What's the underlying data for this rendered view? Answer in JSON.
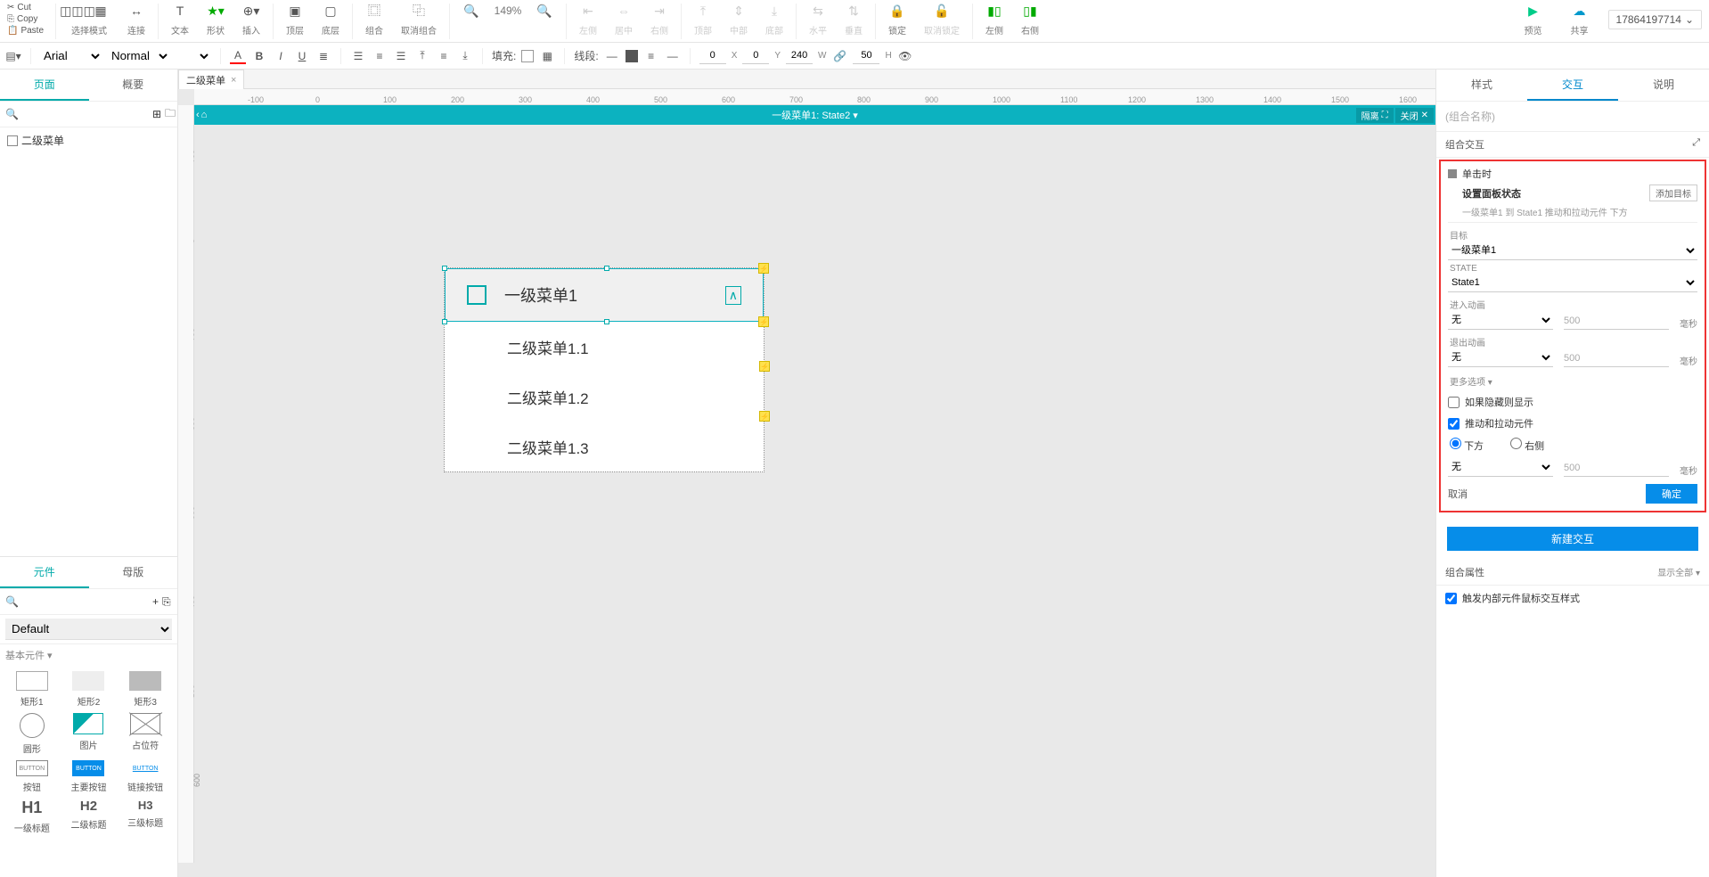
{
  "toolbar": {
    "clipboard": {
      "cut": "Cut",
      "copy": "Copy",
      "paste": "Paste"
    },
    "groups": {
      "selectmode": "选择模式",
      "connect": "连接",
      "text": "文本",
      "shape": "形状",
      "insert": "插入",
      "front": "顶层",
      "back": "底层",
      "group": "组合",
      "ungroup": "取消组合",
      "left": "左侧",
      "center": "居中",
      "right": "右侧",
      "top": "顶部",
      "middle": "中部",
      "bottom": "底部",
      "horiz": "水平",
      "vert": "垂直",
      "lock": "锁定",
      "unlock": "取消锁定",
      "leftpane": "左侧",
      "rightpane": "右侧",
      "preview": "预览",
      "share": "共享"
    },
    "zoom": "149%",
    "account": "17864197714"
  },
  "toolbar2": {
    "font": "Arial",
    "style": "Normal",
    "fill": "填充:",
    "line": "线段:",
    "x": "0",
    "y": "0",
    "w": "240",
    "h": "50",
    "xl": "X",
    "yl": "Y",
    "wl": "W",
    "hl": "H"
  },
  "leftPanel": {
    "tabs": {
      "pages": "页面",
      "outline": "概要"
    },
    "tree": [
      "二级菜单"
    ],
    "widgetsTabs": {
      "widgets": "元件",
      "masters": "母版"
    },
    "libDefault": "Default",
    "section": "基本元件 ▾",
    "widgets": [
      {
        "lbl": "矩形1",
        "t": "rect"
      },
      {
        "lbl": "矩形2",
        "t": "rectf"
      },
      {
        "lbl": "矩形3",
        "t": "rectd"
      },
      {
        "lbl": "圆形",
        "t": "circle"
      },
      {
        "lbl": "图片",
        "t": "img"
      },
      {
        "lbl": "占位符",
        "t": "ph"
      },
      {
        "lbl": "按钮",
        "t": "btn"
      },
      {
        "lbl": "主要按钮",
        "t": "btnP"
      },
      {
        "lbl": "链接按钮",
        "t": "btnL"
      },
      {
        "lbl": "一级标题",
        "t": "h1"
      },
      {
        "lbl": "二级标题",
        "t": "h2"
      },
      {
        "lbl": "三级标题",
        "t": "h3"
      }
    ]
  },
  "canvas": {
    "tab": "二级菜单",
    "dpHeader": "一级菜单1: State2 ▾",
    "isolate": "隔离",
    "close": "关闭",
    "menuTop": "一级菜单1",
    "subs": [
      "二级菜单1.1",
      "二级菜单1.2",
      "二级菜单1.3"
    ],
    "hTicks": [
      -100,
      0,
      100,
      200,
      300,
      400,
      500,
      600,
      700,
      800,
      900,
      1000,
      1100,
      1200,
      1300,
      1400,
      1500,
      1600
    ],
    "vTicks": [
      -100,
      0,
      100,
      200,
      300,
      400,
      500,
      600
    ]
  },
  "rightPanel": {
    "tabs": {
      "style": "样式",
      "interact": "交互",
      "notes": "说明"
    },
    "nameHint": "(组合名称)",
    "secCombo": "组合交互",
    "event": "单击时",
    "action": "设置面板状态",
    "addTarget": "添加目标",
    "desc": "一级菜单1 到 State1 推动和拉动元件 下方",
    "targetLbl": "目标",
    "target": "一级菜单1",
    "stateLbl": "STATE",
    "state": "State1",
    "animInLbl": "进入动画",
    "animIn": "无",
    "animInMs": "500",
    "animOutLbl": "退出动画",
    "animOut": "无",
    "animOutMs": "500",
    "ms": "毫秒",
    "moreLbl": "更多选项 ▾",
    "showIfHidden": "如果隐藏则显示",
    "pushPull": "推动和拉动元件",
    "dirBelow": "下方",
    "dirRight": "右侧",
    "pushAnim": "无",
    "pushMs": "500",
    "cancel": "取消",
    "ok": "确定",
    "newInteraction": "新建交互",
    "comboProps": "组合属性",
    "showAll": "显示全部 ▾",
    "triggerMouse": "触发内部元件鼠标交互样式"
  }
}
